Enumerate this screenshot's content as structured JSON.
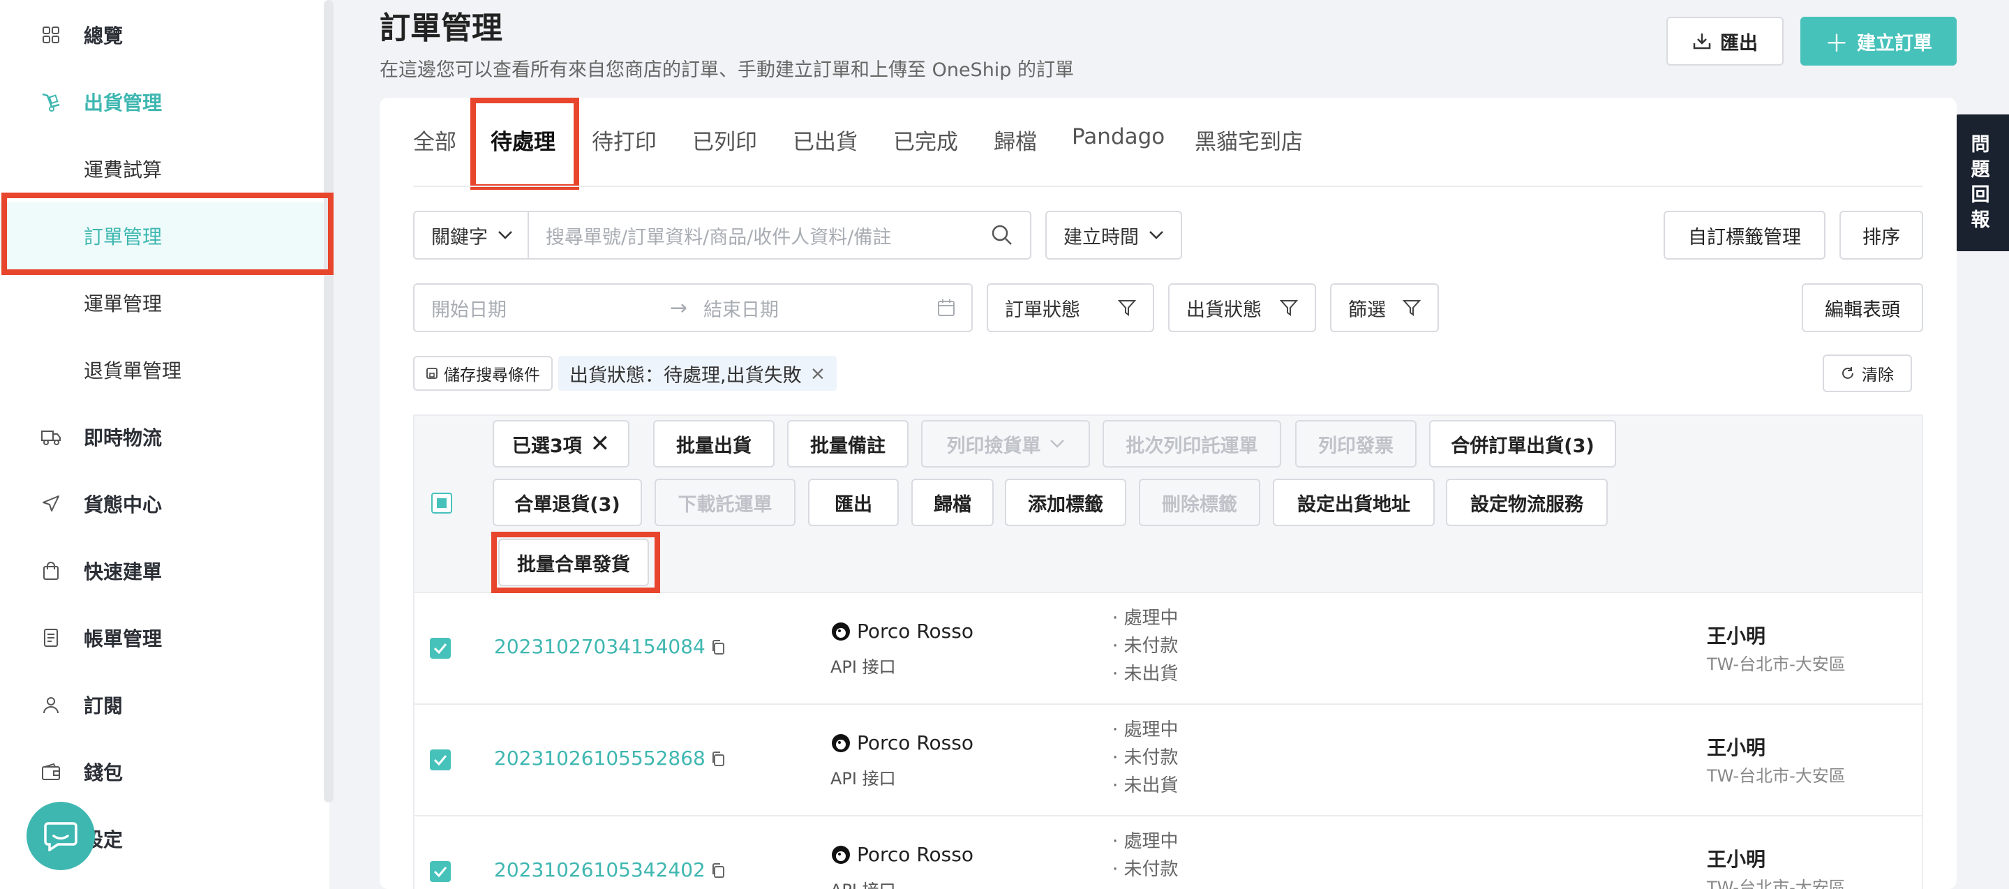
{
  "sidebar": {
    "items": [
      {
        "label": "總覽"
      },
      {
        "label": "出貨管理"
      },
      {
        "label": "運費試算"
      },
      {
        "label": "訂單管理"
      },
      {
        "label": "運單管理"
      },
      {
        "label": "退貨單管理"
      },
      {
        "label": "即時物流"
      },
      {
        "label": "貨態中心"
      },
      {
        "label": "快速建單"
      },
      {
        "label": "帳單管理"
      },
      {
        "label": "訂閱"
      },
      {
        "label": "錢包"
      },
      {
        "label": "設定"
      }
    ]
  },
  "header": {
    "title": "訂單管理",
    "subtitle": "在這邊您可以查看所有來自您商店的訂單、手動建立訂單和上傳至 OneShip 的訂單",
    "export_label": "匯出",
    "create_label": "建立訂單"
  },
  "tabs": [
    {
      "label": "全部"
    },
    {
      "label": "待處理"
    },
    {
      "label": "待打印"
    },
    {
      "label": "已列印"
    },
    {
      "label": "已出貨"
    },
    {
      "label": "已完成"
    },
    {
      "label": "歸檔"
    },
    {
      "label": "Pandago"
    },
    {
      "label": "黑貓宅到店"
    }
  ],
  "filters": {
    "keyword_label": "關鍵字",
    "search_placeholder": "搜尋單號/訂單資料/商品/收件人資料/備註",
    "created_time_label": "建立時間",
    "tag_manage_label": "自訂標籤管理",
    "sort_label": "排序",
    "start_date_placeholder": "開始日期",
    "end_date_placeholder": "結束日期",
    "order_status_label": "訂單狀態",
    "shipping_status_label": "出貨狀態",
    "filter_label": "篩選",
    "edit_header_label": "編輯表頭",
    "save_search_label": "儲存搜尋條件",
    "active_chip": "出貨狀態：待處理,出貨失敗",
    "clear_label": "清除"
  },
  "bulk_actions": {
    "selected_label": "已選3項",
    "row1": [
      "批量出貨",
      "批量備註",
      "列印撿貨單",
      "批次列印託運單",
      "列印發票",
      "合併訂單出貨(3)"
    ],
    "row2": [
      "合單退貨(3)",
      "下載託運單",
      "匯出",
      "歸檔",
      "添加標籤",
      "刪除標籤",
      "設定出貨地址",
      "設定物流服務"
    ],
    "row3": [
      "批量合單發貨"
    ]
  },
  "orders": [
    {
      "order_no": "20231027034154084",
      "shop": "Porco Rosso",
      "channel": "API 接口",
      "status": [
        "· 處理中",
        "· 未付款",
        "· 未出貨"
      ],
      "customer": "王小明",
      "address": "TW-台北市-大安區"
    },
    {
      "order_no": "20231026105552868",
      "shop": "Porco Rosso",
      "channel": "API 接口",
      "status": [
        "· 處理中",
        "· 未付款",
        "· 未出貨"
      ],
      "customer": "王小明",
      "address": "TW-台北市-大安區"
    },
    {
      "order_no": "20231026105342402",
      "shop": "Porco Rosso",
      "channel": "API 接口",
      "status": [
        "· 處理中",
        "· 未付款"
      ],
      "customer": "王小明",
      "address": "TW-台北市-大安區"
    }
  ],
  "feedback": {
    "chars": [
      "問",
      "題",
      "回",
      "報"
    ]
  },
  "colors": {
    "accent": "#47c2bb",
    "highlight": "#e8452d",
    "feedback_bg": "#1a2230"
  }
}
